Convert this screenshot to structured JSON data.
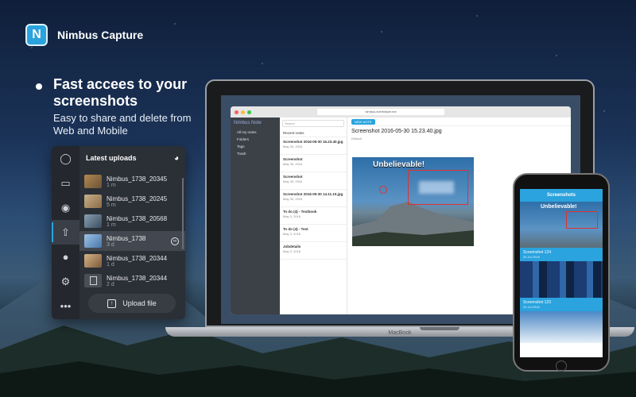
{
  "brand": {
    "logo": "N",
    "name": "Nimbus Capture"
  },
  "hero": {
    "headline": "Fast accees to your screenshots",
    "subline": "Easy to share and delete from Web and Mobile"
  },
  "panel": {
    "title": "Latest uploads",
    "rail_icons": [
      "camera-icon",
      "video-icon",
      "palette-icon",
      "upload-icon",
      "stamp-icon",
      "settings-icon",
      "more-icon"
    ],
    "items": [
      {
        "name": "Nimbus_1738_20345",
        "age": "1 m"
      },
      {
        "name": "Nimbus_1738_20245",
        "age": "5 m"
      },
      {
        "name": "Nimbus_1738_20568",
        "age": "1 m"
      },
      {
        "name": "Nimbus_1738",
        "age": "3 d"
      },
      {
        "name": "Nimbus_1738_20344",
        "age": "1 d"
      },
      {
        "name": "Nimbus_1738_20344",
        "age": "2 d"
      }
    ],
    "upload_label": "Upload file"
  },
  "laptop": {
    "brand": "MacBook",
    "url": "nimbus.everhelper.me",
    "app": {
      "logo": "Nimbus Note",
      "nav": [
        "All my notes",
        "Folders",
        "Tags",
        "Trash"
      ],
      "search_placeholder": "Search",
      "new_note": "NEW NOTE",
      "notes_title": "Recent notes",
      "notes": [
        {
          "name": "Screenshot 2016-05-30 15.23.40.jpg",
          "date": "May 30, 2016"
        },
        {
          "name": "Screenshot",
          "date": "May 30, 2016"
        },
        {
          "name": "Screenshot",
          "date": "May 30, 2016"
        },
        {
          "name": "Screenshot 2016-05-30 14.11.10.jpg",
          "date": "May 30, 2016"
        },
        {
          "name": "To do (4) - Textbook",
          "date": "May 3, 2016"
        },
        {
          "name": "To do (4) - Test",
          "date": "May 3, 2016"
        },
        {
          "name": "Jobdetails",
          "date": "May 3, 2016"
        }
      ],
      "doc_title": "Screenshot 2016-05-30 15.23.40.jpg",
      "doc_meta": "Default",
      "shot_text": "Unbelievable!"
    }
  },
  "phone": {
    "header": "Screenshots",
    "shot_text": "Unbelievable!",
    "cards": [
      {
        "title": "Screenshot 124",
        "date": "20 Jul 2016"
      },
      {
        "title": "Screenshot 123",
        "date": "20 Jul 2016"
      }
    ]
  },
  "colors": {
    "accent": "#2aa3de",
    "panel_bg": "#2b2f36",
    "annotation": "#e03131"
  }
}
